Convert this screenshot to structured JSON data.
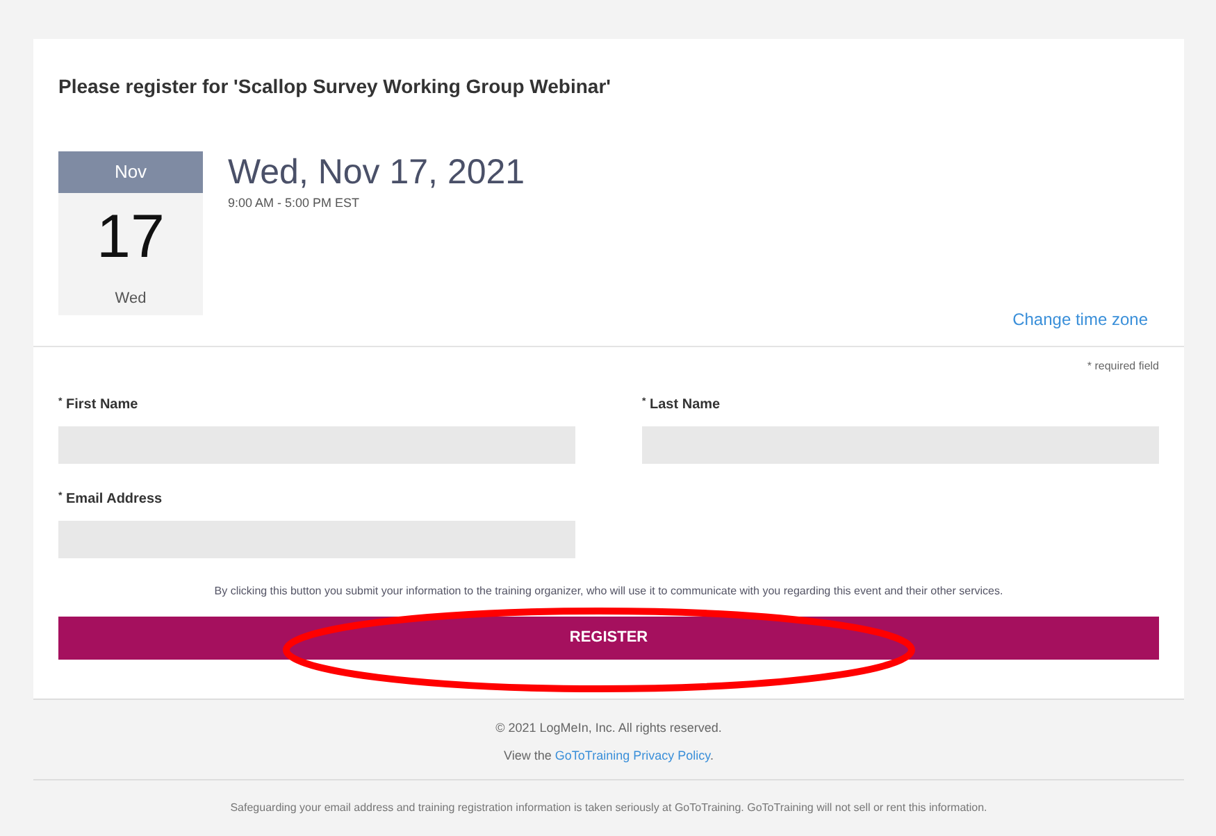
{
  "title": "Please register for 'Scallop Survey Working Group Webinar'",
  "date_card": {
    "month": "Nov",
    "day": "17",
    "weekday": "Wed"
  },
  "date_heading": "Wed, Nov 17, 2021",
  "time_range": "9:00 AM - 5:00 PM EST",
  "change_time_zone": "Change time zone",
  "required_note": "* required field",
  "fields": [
    {
      "label": "First Name",
      "required_mark": "*"
    },
    {
      "label": "Last Name",
      "required_mark": "*"
    },
    {
      "label": "Email Address",
      "required_mark": "*"
    }
  ],
  "consent": "By clicking this button you submit your information to the training organizer, who will use it to communicate with you regarding this event and their other services.",
  "register_button": "REGISTER",
  "footer": {
    "copyright": "© 2021 LogMeIn, Inc. All rights reserved.",
    "privacy_prefix": "View the",
    "privacy_link": "GoToTraining Privacy Policy",
    "privacy_suffix": ".",
    "safeguard": "Safeguarding your email address and training registration information is taken seriously at GoToTraining. GoToTraining will not sell or rent this information."
  }
}
